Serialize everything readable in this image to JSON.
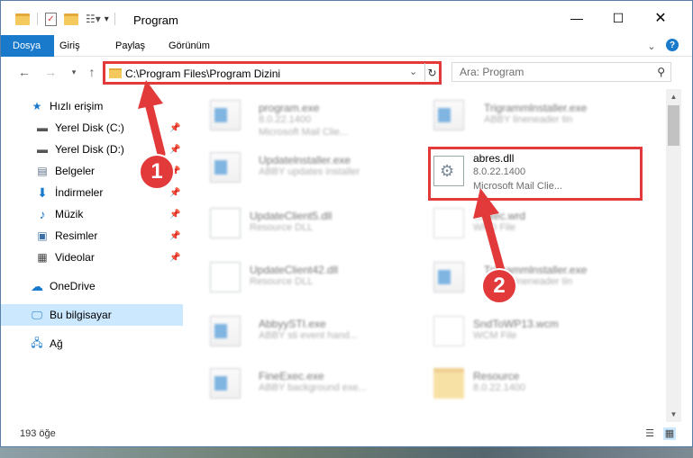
{
  "window": {
    "title": "Program"
  },
  "ribbon": {
    "tabs": [
      "Dosya",
      "Giriş",
      "Paylaş",
      "Görünüm"
    ]
  },
  "nav": {
    "address": "C:\\Program Files\\Program Dizini",
    "search_placeholder": "Ara: Program"
  },
  "sidebar": {
    "items": [
      {
        "label": "Hızlı erişim"
      },
      {
        "label": "Yerel Disk (C:)"
      },
      {
        "label": "Yerel Disk (D:)"
      },
      {
        "label": "Belgeler"
      },
      {
        "label": "İndirmeler"
      },
      {
        "label": "Müzik"
      },
      {
        "label": "Resimler"
      },
      {
        "label": "Videolar"
      },
      {
        "label": "OneDrive"
      },
      {
        "label": "Bu bilgisayar"
      },
      {
        "label": "Ağ"
      }
    ]
  },
  "files": [
    {
      "name": "program.exe",
      "meta1": "8.0.22.1400",
      "meta2": "Microsoft Mail Clie..."
    },
    {
      "name": "Trigrammlnstaller.exe",
      "meta1": "ABBY lineneader tin",
      "meta2": ""
    },
    {
      "name": "Updatelnstaller.exe",
      "meta1": "ABBY updates installer",
      "meta2": ""
    },
    {
      "name": "abres.dll",
      "meta1": "8.0.22.1400",
      "meta2": "Microsoft Mail Clie..."
    },
    {
      "name": "UpdateClient5.dll",
      "meta1": "Resource DLL",
      "meta2": ""
    },
    {
      "name": "...exec.wrd",
      "meta1": "WRD File",
      "meta2": ""
    },
    {
      "name": "UpdateClient42.dll",
      "meta1": "Resource DLL",
      "meta2": ""
    },
    {
      "name": "Trigrammlnstaller.exe",
      "meta1": "ABBY lineneader tin",
      "meta2": ""
    },
    {
      "name": "AbbyySTI.exe",
      "meta1": "ABBY sti event hand...",
      "meta2": ""
    },
    {
      "name": "SndToWP13.wcm",
      "meta1": "WCM File",
      "meta2": ""
    },
    {
      "name": "FineExec.exe",
      "meta1": "ABBY background exe...",
      "meta2": ""
    },
    {
      "name": "Resource",
      "meta1": "8.0.22.1400",
      "meta2": ""
    }
  ],
  "status": {
    "count": "193 öğe"
  },
  "annotations": {
    "step1": "1",
    "step2": "2"
  },
  "colors": {
    "accent": "#1979ca",
    "highlight": "#e23a3a",
    "selected": "#cce8ff"
  }
}
